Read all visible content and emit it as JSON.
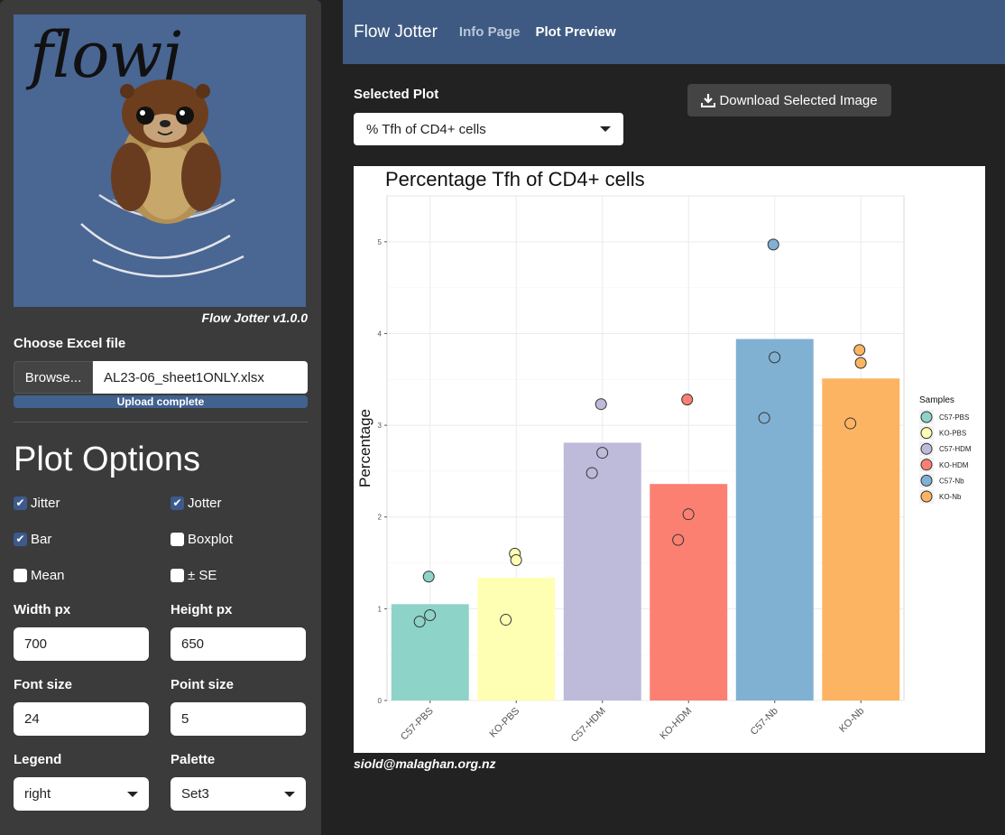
{
  "sidebar": {
    "logo_text": "flowj",
    "version": "Flow Jotter v1.0.0",
    "file": {
      "label": "Choose Excel file",
      "browse_label": "Browse...",
      "filename": "AL23-06_sheet1ONLY.xlsx",
      "progress_text": "Upload complete"
    },
    "plot_options": {
      "title": "Plot Options",
      "checkboxes": [
        {
          "label": "Jitter",
          "checked": true
        },
        {
          "label": "Jotter",
          "checked": true
        },
        {
          "label": "Bar",
          "checked": true
        },
        {
          "label": "Boxplot",
          "checked": false
        },
        {
          "label": "Mean",
          "checked": false
        },
        {
          "label": "± SE",
          "checked": false
        }
      ],
      "width_label": "Width px",
      "width_value": "700",
      "height_label": "Height px",
      "height_value": "650",
      "font_size_label": "Font size",
      "font_size_value": "24",
      "point_size_label": "Point size",
      "point_size_value": "5",
      "legend_label": "Legend",
      "legend_value": "right",
      "palette_label": "Palette",
      "palette_value": "Set3"
    }
  },
  "navbar": {
    "brand": "Flow Jotter",
    "links": [
      "Info Page",
      "Plot Preview"
    ],
    "active": "Plot Preview"
  },
  "main": {
    "selected_plot_label": "Selected Plot",
    "selected_plot_value": "% Tfh of CD4+ cells",
    "download_label": "Download Selected Image",
    "footer_email": "siold@malaghan.org.nz"
  },
  "icons": {
    "download": "download-icon",
    "dropdown": "chevron-down-icon",
    "check": "check-icon"
  },
  "chart_data": {
    "type": "bar",
    "title": "Percentage Tfh of CD4+ cells",
    "ylabel": "Percentage",
    "xlabel": "",
    "ylim": [
      0,
      5.5
    ],
    "yticks": [
      0,
      1,
      2,
      3,
      4,
      5
    ],
    "categories": [
      "C57-PBS",
      "KO-PBS",
      "C57-HDM",
      "KO-HDM",
      "C57-Nb",
      "KO-Nb"
    ],
    "values": [
      1.05,
      1.34,
      2.81,
      2.36,
      3.94,
      3.51
    ],
    "colors": [
      "#8DD3C7",
      "#FFFFB3",
      "#BEBADA",
      "#FB8072",
      "#80B1D3",
      "#FDB462"
    ],
    "points": [
      [
        {
          "y": 1.35,
          "filled": true
        },
        {
          "y": 0.93,
          "filled": false
        },
        {
          "y": 0.86,
          "filled": false
        }
      ],
      [
        {
          "y": 1.6,
          "filled": true
        },
        {
          "y": 1.53,
          "filled": true
        },
        {
          "y": 0.88,
          "filled": false
        }
      ],
      [
        {
          "y": 3.23,
          "filled": true
        },
        {
          "y": 2.7,
          "filled": false
        },
        {
          "y": 2.48,
          "filled": false
        }
      ],
      [
        {
          "y": 3.28,
          "filled": true
        },
        {
          "y": 2.03,
          "filled": false
        },
        {
          "y": 1.75,
          "filled": false
        }
      ],
      [
        {
          "y": 4.97,
          "filled": true
        },
        {
          "y": 3.74,
          "filled": false
        },
        {
          "y": 3.08,
          "filled": false
        }
      ],
      [
        {
          "y": 3.82,
          "filled": true
        },
        {
          "y": 3.68,
          "filled": true
        },
        {
          "y": 3.02,
          "filled": false
        }
      ]
    ],
    "legend": {
      "title": "Samples",
      "entries": [
        "C57-PBS",
        "KO-PBS",
        "C57-HDM",
        "KO-HDM",
        "C57-Nb",
        "KO-Nb"
      ],
      "position": "right"
    },
    "grid": true
  }
}
